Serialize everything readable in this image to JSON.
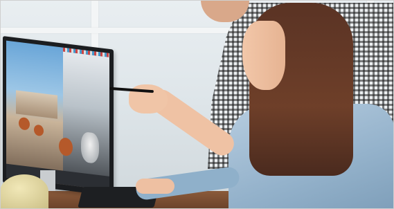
{
  "scene": {
    "description_type": "photo",
    "colors": {
      "window": "#dfe6ea",
      "desk": "#7a4c32",
      "monitor_bezel": "#1b1d20",
      "shirt_denim": "#94b2cb",
      "hair": "#5a3324",
      "skin": "#efc2a4"
    }
  }
}
